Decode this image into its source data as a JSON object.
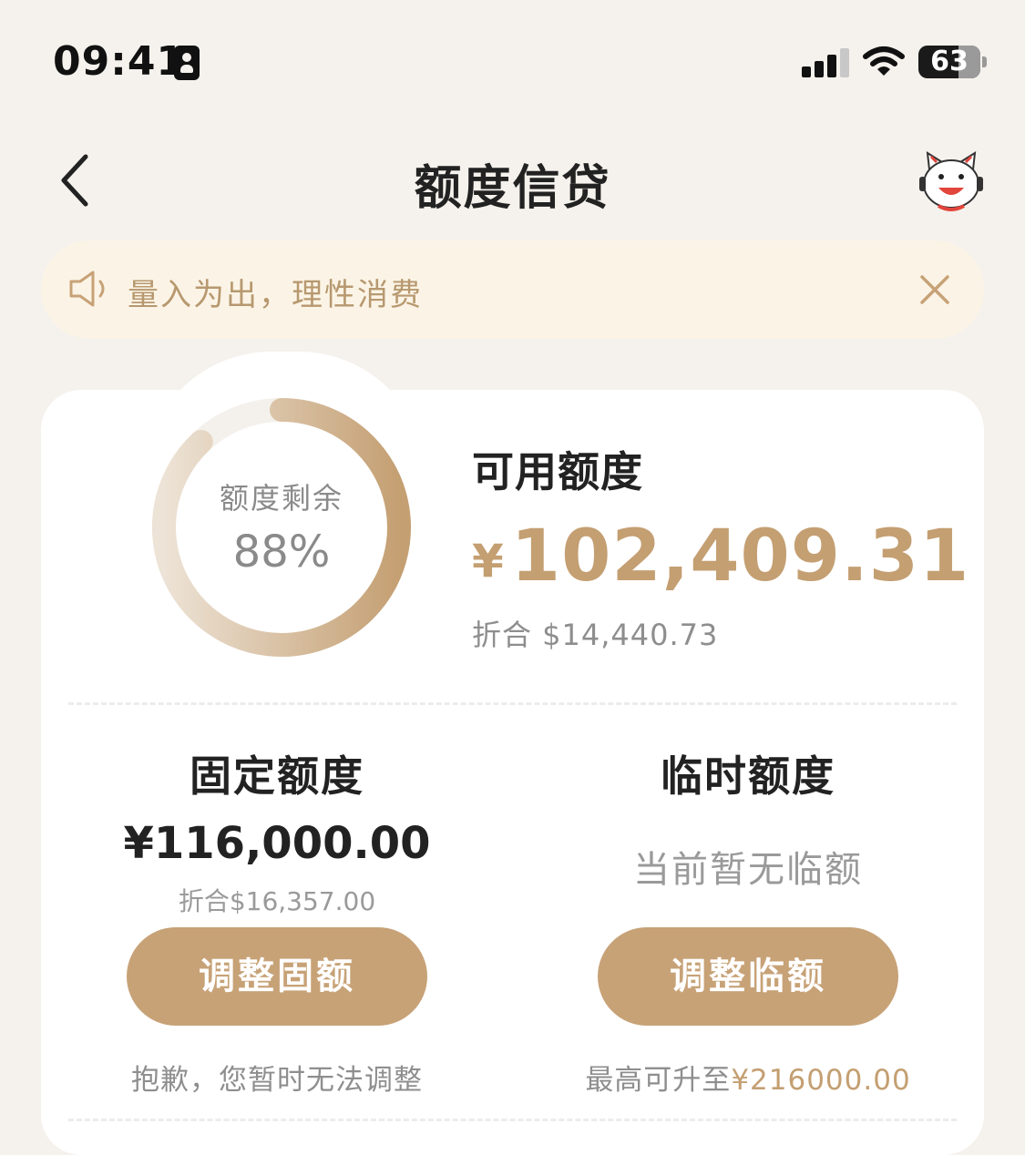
{
  "status_bar": {
    "time": "09:41",
    "battery": "63",
    "icons": [
      "sim-card-icon",
      "cellular-signal-icon",
      "wifi-icon",
      "battery-icon"
    ]
  },
  "nav": {
    "back_icon": "chevron-left-icon",
    "title": "额度信贷",
    "mascot_icon": "cat-mascot-icon"
  },
  "notice": {
    "icon": "speaker-icon",
    "text": "量入为出，理性消费",
    "close_icon": "close-icon"
  },
  "summary": {
    "ring_label": "额度剩余",
    "ring_percent_text": "88%",
    "remaining_fraction": 0.88,
    "available_label": "可用额度",
    "currency_symbol": "¥",
    "available_amount": "102,409.31",
    "available_usd": "折合 $14,440.73"
  },
  "fixed": {
    "title": "固定额度",
    "amount": "¥116,000.00",
    "usd": "折合$16,357.00",
    "button_label": "调整固额",
    "note": "抱歉，您暂时无法调整"
  },
  "temporary": {
    "title": "临时额度",
    "status": "当前暂无临额",
    "button_label": "调整临额",
    "note_prefix": "最高可升至",
    "note_amount": "¥216000.00"
  },
  "colors": {
    "background": "#f5f1ec",
    "accent": "#c49f72",
    "button": "#c7a277",
    "notice_bg": "#fbf4e6"
  }
}
